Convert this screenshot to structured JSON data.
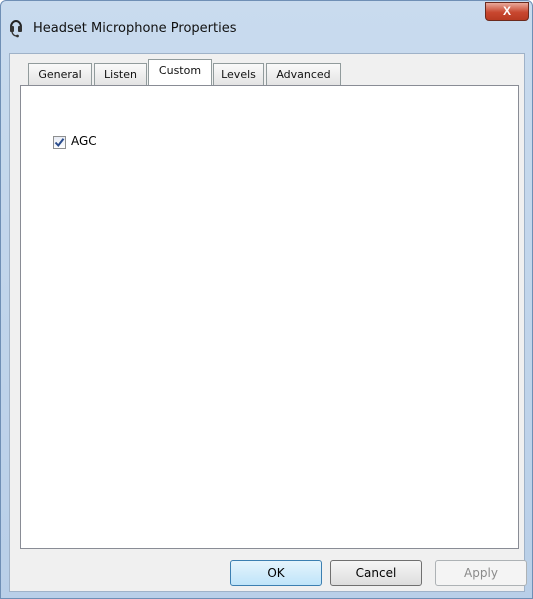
{
  "window": {
    "title": "Headset Microphone Properties",
    "close_label": "X",
    "icon": "headset-icon"
  },
  "tabs": [
    {
      "label": "General"
    },
    {
      "label": "Listen"
    },
    {
      "label": "Custom"
    },
    {
      "label": "Levels"
    },
    {
      "label": "Advanced"
    }
  ],
  "active_tab": "Custom",
  "custom": {
    "agc_label": "AGC",
    "agc_checked": true
  },
  "buttons": {
    "ok": "OK",
    "cancel": "Cancel",
    "apply": "Apply"
  },
  "colors": {
    "titlebar": "#c9dbee",
    "close": "#c8472f",
    "panel": "#ffffff",
    "dialog_bg": "#f0f0f0"
  }
}
